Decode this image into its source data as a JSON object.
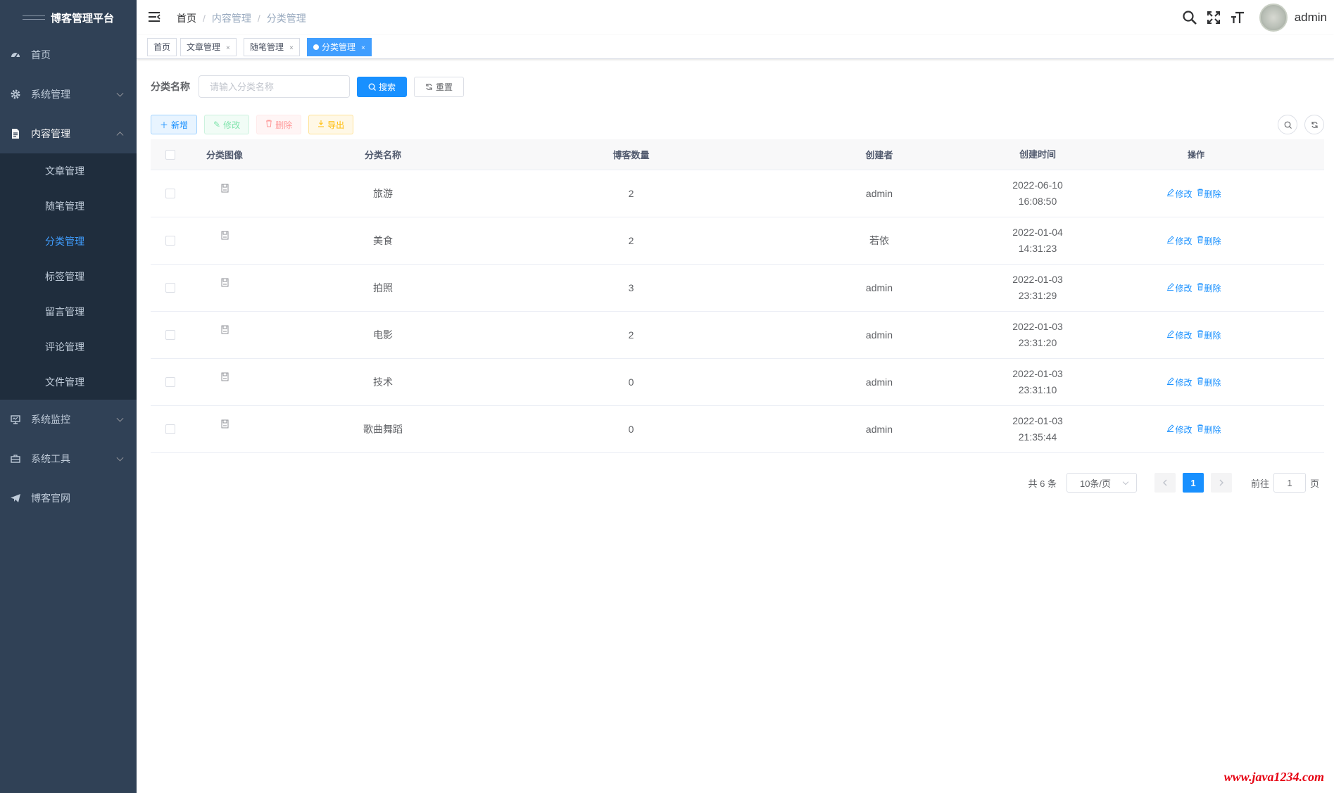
{
  "app": {
    "title": "博客管理平台"
  },
  "sidebar": {
    "items": [
      {
        "label": "首页",
        "icon": "dashboard-icon"
      },
      {
        "label": "系统管理",
        "icon": "gear-icon"
      },
      {
        "label": "内容管理",
        "icon": "document-icon"
      },
      {
        "label": "系统监控",
        "icon": "monitor-icon"
      },
      {
        "label": "系统工具",
        "icon": "toolbox-icon"
      },
      {
        "label": "博客官网",
        "icon": "send-icon"
      }
    ],
    "submenu": [
      {
        "label": "文章管理"
      },
      {
        "label": "随笔管理"
      },
      {
        "label": "分类管理"
      },
      {
        "label": "标签管理"
      },
      {
        "label": "留言管理"
      },
      {
        "label": "评论管理"
      },
      {
        "label": "文件管理"
      }
    ]
  },
  "navbar": {
    "breadcrumb": [
      "首页",
      "内容管理",
      "分类管理"
    ],
    "username": "admin"
  },
  "tags": [
    {
      "label": "首页"
    },
    {
      "label": "文章管理"
    },
    {
      "label": "随笔管理"
    },
    {
      "label": "分类管理"
    }
  ],
  "search": {
    "label": "分类名称",
    "placeholder": "请输入分类名称",
    "value": "",
    "search_label": "搜索",
    "reset_label": "重置"
  },
  "toolbar": {
    "add": "新增",
    "edit": "修改",
    "delete": "删除",
    "export": "导出"
  },
  "table": {
    "headers": [
      "分类图像",
      "分类名称",
      "博客数量",
      "创建者",
      "创建时间",
      "操作"
    ],
    "edit_label": "修改",
    "delete_label": "删除",
    "rows": [
      {
        "name": "旅游",
        "count": "2",
        "creator": "admin",
        "date": "2022-06-10",
        "time": "16:08:50"
      },
      {
        "name": "美食",
        "count": "2",
        "creator": "若依",
        "date": "2022-01-04",
        "time": "14:31:23"
      },
      {
        "name": "拍照",
        "count": "3",
        "creator": "admin",
        "date": "2022-01-03",
        "time": "23:31:29"
      },
      {
        "name": "电影",
        "count": "2",
        "creator": "admin",
        "date": "2022-01-03",
        "time": "23:31:20"
      },
      {
        "name": "技术",
        "count": "0",
        "creator": "admin",
        "date": "2022-01-03",
        "time": "23:31:10"
      },
      {
        "name": "歌曲舞蹈",
        "count": "0",
        "creator": "admin",
        "date": "2022-01-03",
        "time": "21:35:44"
      }
    ]
  },
  "pagination": {
    "total": "共 6 条",
    "page_size": "10条/页",
    "current": "1",
    "goto_prefix": "前往",
    "goto_value": "1",
    "goto_suffix": "页"
  },
  "watermark": "www.java1234.com",
  "colors": {
    "sidebar_bg": "#304156",
    "submenu_bg": "#1f2d3d",
    "primary": "#1890ff",
    "active_tag": "#409eff"
  }
}
